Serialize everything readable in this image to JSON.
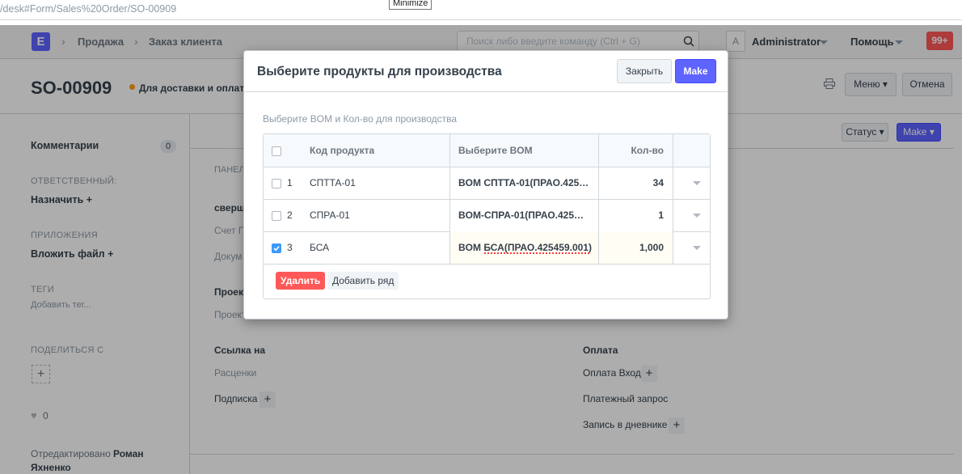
{
  "browser": {
    "url": "/desk#Form/Sales%20Order/SO-00909",
    "tooltip": "Minimize"
  },
  "navbar": {
    "logo_letter": "E",
    "breadcrumbs": [
      "Продажа",
      "Заказ клиента"
    ],
    "search_placeholder": "Поиск либо введите команду (Ctrl + G)",
    "avatar_letter": "A",
    "user": "Administrator",
    "help": "Помощь",
    "notifications": "99+"
  },
  "page": {
    "title": "SO-00909",
    "status": "Для доставки и оплаты",
    "menu_label": "Меню",
    "cancel_label": "Отмена",
    "status_btn": "Статус",
    "make_btn": "Make"
  },
  "sidebar": {
    "comments_label": "Комментарии",
    "comments_count": "0",
    "assigned_heading": "ОТВЕТСТВЕННЫЙ:",
    "assign_label": "Назначить",
    "attachments_heading": "ПРИЛОЖЕНИЯ",
    "attach_label": "Вложить файл",
    "tags_heading": "ТЕГИ",
    "add_tag": "Добавить тег...",
    "share_heading": "ПОДЕЛИТЬСЯ С",
    "likes": "0",
    "edited_prefix": "Отредактировано",
    "edited_by": "Роман Яхненко"
  },
  "main": {
    "panel_label": "ПАНЕЛ",
    "done_label": "сверш",
    "invoice_label": "Счет П",
    "docs_label": "Докум",
    "project_heading": "Проект",
    "project_label": "Проект",
    "links_heading": "Ссылка на",
    "prices_label": "Расценки",
    "subscription_label": "Подписка",
    "payment_heading": "Оплата",
    "payment_entry_label": "Оплата Вход",
    "payment_request_label": "Платежный запрос",
    "journal_label": "Запись в дневнике"
  },
  "modal": {
    "title": "Выберите продукты для производства",
    "close_label": "Закрыть",
    "make_label": "Make",
    "section_label": "Выберите BOM и Кол-во для производства",
    "columns": [
      "Код продукта",
      "Выберите BOM",
      "Кол-во"
    ],
    "rows": [
      {
        "idx": "1",
        "item": "СПТТА-01",
        "bom": "BOM СПТТА-01(ПРАО.425…",
        "qty": "34",
        "checked": false
      },
      {
        "idx": "2",
        "item": "СПРА-01",
        "bom": "BOM-СПРА-01(ПРАО.425…",
        "qty": "1",
        "checked": false
      },
      {
        "idx": "3",
        "item": "БСА",
        "bom": "BOM БСА(ПРАО.425459.001)",
        "qty": "1,000",
        "checked": true
      }
    ],
    "delete_label": "Удалить",
    "add_row_label": "Добавить ряд"
  },
  "colors": {
    "primary": "#5e64ff",
    "danger": "#ff5858",
    "indicator": "#ffa00a"
  }
}
